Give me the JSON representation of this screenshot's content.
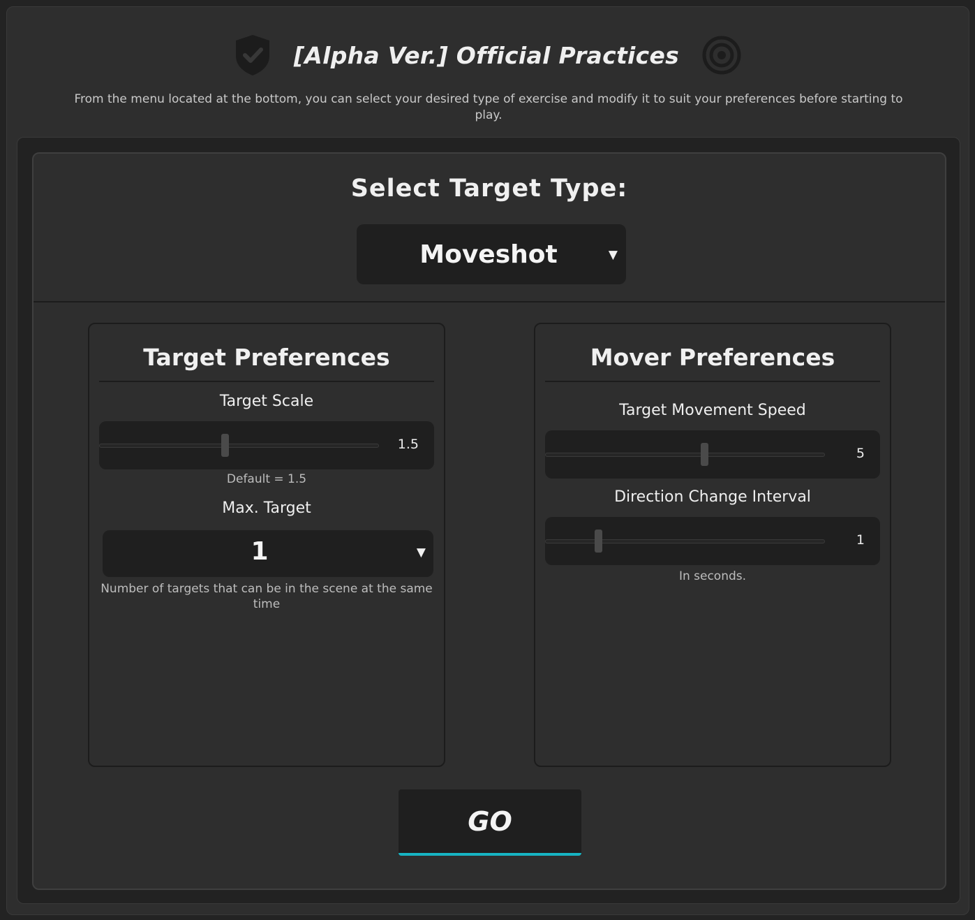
{
  "header": {
    "title": "[Alpha Ver.] Official Practices",
    "description": "From the menu located at the bottom, you can select your desired type of exercise and modify it to suit your preferences before starting to play."
  },
  "target_type": {
    "heading": "Select Target Type:",
    "selected": "Moveshot",
    "chevron": "▼"
  },
  "target_preferences": {
    "title": "Target Preferences",
    "scale": {
      "label": "Target Scale",
      "value": "1.5",
      "level": 0.45,
      "hint": "Default = 1.5"
    },
    "max_target": {
      "label": "Max. Target",
      "selected": "1",
      "chevron": "▼",
      "hint": "Number of targets that can be in the scene at the same time"
    }
  },
  "mover_preferences": {
    "title": "Mover Preferences",
    "speed": {
      "label": "Target Movement Speed",
      "value": "5",
      "level": 0.57
    },
    "interval": {
      "label": "Direction Change Interval",
      "value": "1",
      "level": 0.19,
      "hint": "In seconds."
    }
  },
  "go_button": {
    "label": "GO"
  },
  "colors": {
    "accent": "#17b4c3",
    "background": "#2e2e2e",
    "panel_dark": "#1f1f1f"
  },
  "icons": [
    "shield-check-icon",
    "target-icon",
    "chevron-down-icon"
  ]
}
